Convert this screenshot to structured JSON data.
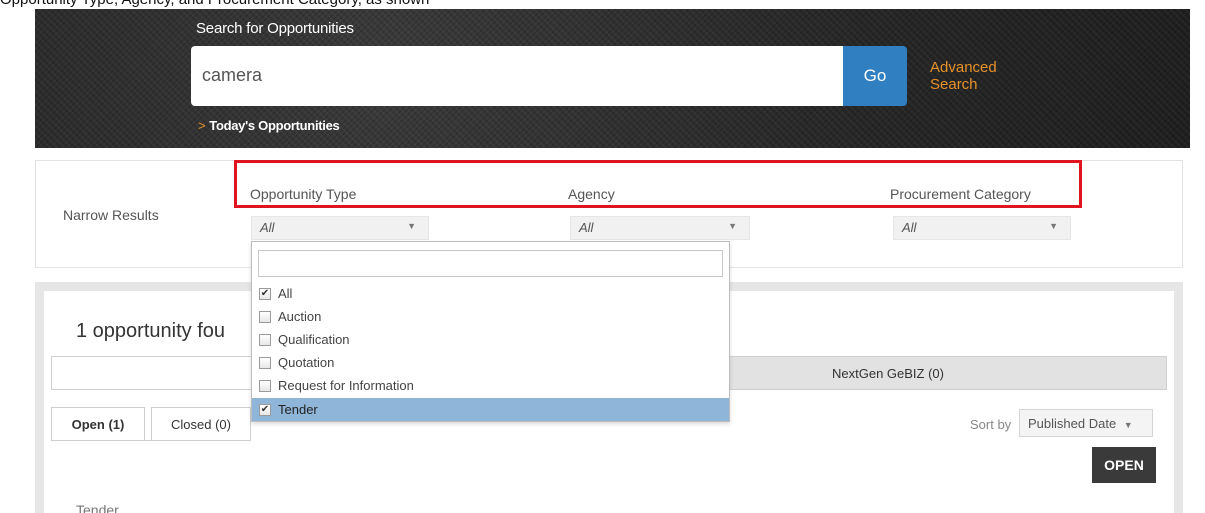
{
  "caption": "Opportunity Type, Agency, and Procurement Category, as shown",
  "banner": {
    "search_label": "Search for Opportunities",
    "search_value": "camera",
    "go_label": "Go",
    "advanced_line1": "Advanced",
    "advanced_line2": "Search",
    "today_chevron": ">",
    "today_label": "Today's Opportunities"
  },
  "narrow": {
    "label": "Narrow Results",
    "filters": [
      {
        "title": "Opportunity Type",
        "value": "All"
      },
      {
        "title": "Agency",
        "value": "All"
      },
      {
        "title": "Procurement Category",
        "value": "All"
      }
    ],
    "caret": "▼"
  },
  "dropdown": {
    "search_value": "",
    "options": [
      {
        "label": "All",
        "checked": true,
        "selected": false
      },
      {
        "label": "Auction",
        "checked": false,
        "selected": false
      },
      {
        "label": "Qualification",
        "checked": false,
        "selected": false
      },
      {
        "label": "Quotation",
        "checked": false,
        "selected": false
      },
      {
        "label": "Request for Information",
        "checked": false,
        "selected": false
      },
      {
        "label": "Tender",
        "checked": true,
        "selected": true
      }
    ],
    "check_glyph": "✔"
  },
  "results": {
    "count_text": "1 opportunity fou",
    "source_tab_right": "NextGen GeBIZ (0)",
    "status_tabs": [
      {
        "label": "Open (1)",
        "active": true
      },
      {
        "label": "Closed (0)",
        "active": false
      }
    ],
    "sort_label": "Sort by",
    "sort_value": "Published Date",
    "sort_caret": "▼",
    "status_badge": "OPEN",
    "item_type": "Tender"
  },
  "colors": {
    "accent_blue": "#2f7fc1",
    "link_orange": "#e6912a",
    "highlight_red": "#e0141e",
    "selected_row": "#8fb6d9",
    "badge_dark": "#3a3a3a"
  }
}
